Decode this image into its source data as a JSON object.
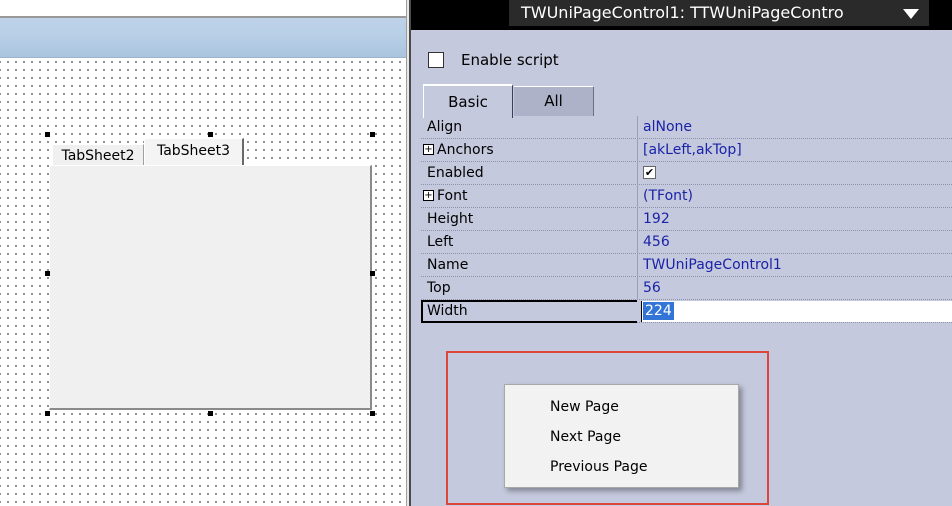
{
  "designer": {
    "tabs": [
      {
        "label": "TabSheet2"
      },
      {
        "label": "TabSheet3"
      }
    ]
  },
  "inspector": {
    "component_selector": "TWUniPageControl1: TTWUniPageContro",
    "enable_script_label": "Enable script",
    "enable_script_checked": false,
    "tabs": [
      {
        "label": "Basic"
      },
      {
        "label": "All"
      }
    ],
    "properties": [
      {
        "name": "Align",
        "value": "alNone"
      },
      {
        "name": "Anchors",
        "value": "[akLeft,akTop]"
      },
      {
        "name": "Enabled",
        "value": "✔"
      },
      {
        "name": "Font",
        "value": "(TFont)"
      },
      {
        "name": "Height",
        "value": "192"
      },
      {
        "name": "Left",
        "value": "456"
      },
      {
        "name": "Name",
        "value": "TWUniPageControl1"
      },
      {
        "name": "Top",
        "value": "56"
      },
      {
        "name": "Width",
        "value": "224"
      }
    ],
    "expand_glyph": "+"
  },
  "context_menu": {
    "items": [
      {
        "label": "New Page"
      },
      {
        "label": "Next Page"
      },
      {
        "label": "Previous Page"
      }
    ]
  },
  "colors": {
    "highlight_frame": "#e0453a",
    "inspector_bg": "#c5c9dd",
    "value_text": "#1a23a8",
    "selection": "#3375d6"
  }
}
